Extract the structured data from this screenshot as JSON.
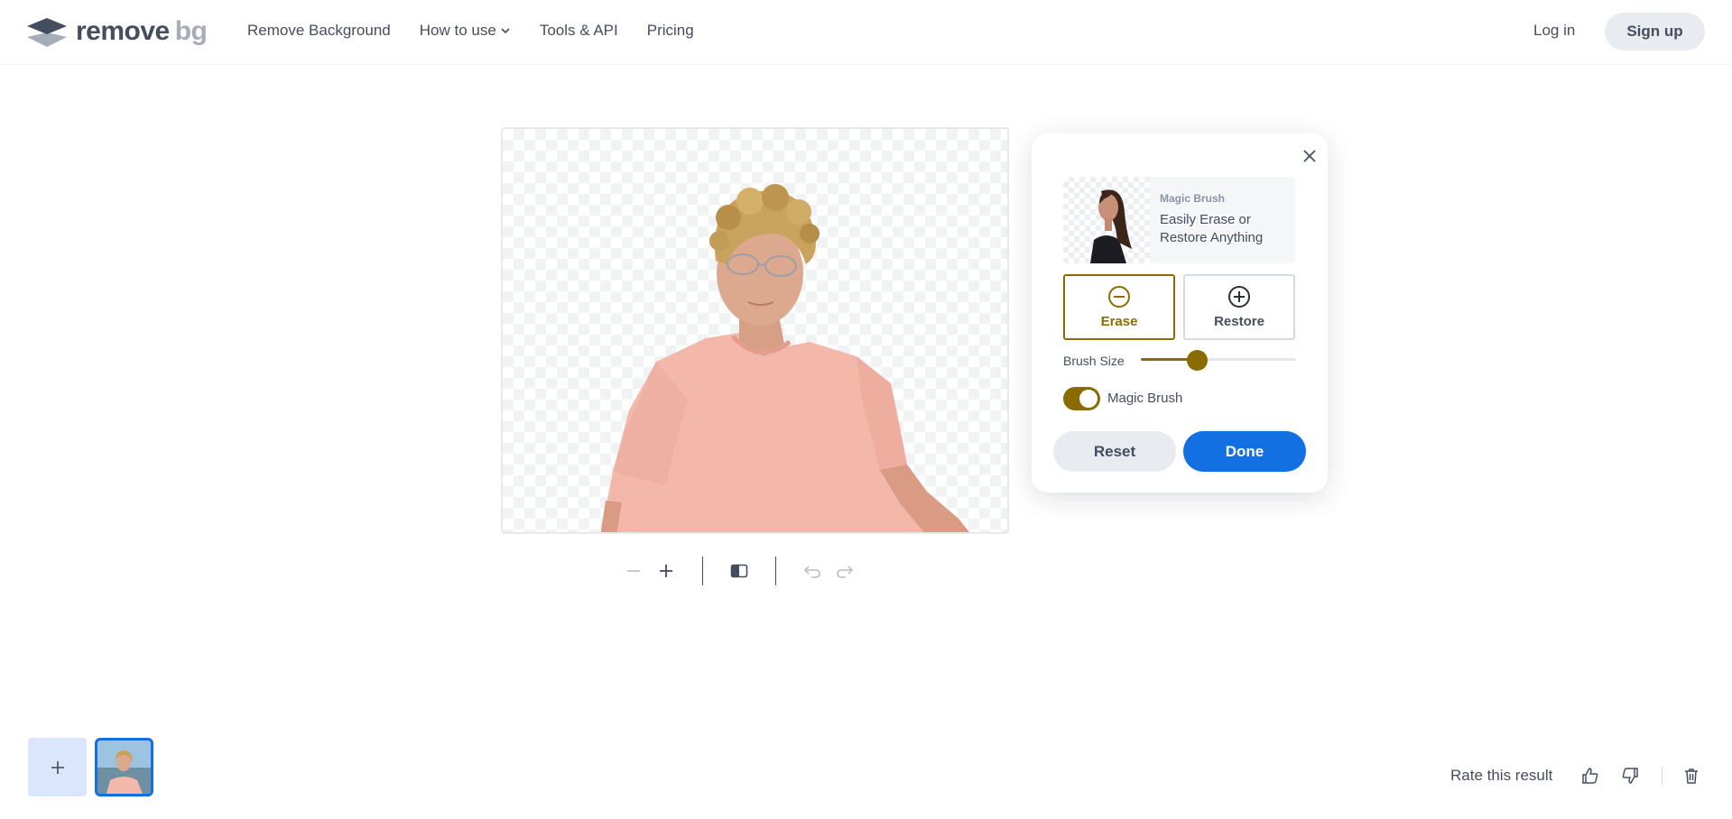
{
  "header": {
    "logo_word": "remove",
    "logo_suffix": "bg",
    "nav": [
      {
        "label": "Remove Background"
      },
      {
        "label": "How to use",
        "has_dropdown": true
      },
      {
        "label": "Tools & API"
      },
      {
        "label": "Pricing"
      }
    ],
    "login_label": "Log in",
    "signup_label": "Sign up"
  },
  "toolbar": {
    "zoom_out_icon": "minus-icon",
    "zoom_in_icon": "plus-icon",
    "compare_icon": "compare-icon",
    "undo_icon": "undo-icon",
    "redo_icon": "redo-icon"
  },
  "panel": {
    "promo_tag": "Magic Brush",
    "promo_text": "Easily Erase or Restore Anything",
    "erase_label": "Erase",
    "restore_label": "Restore",
    "selected_mode": "erase",
    "brush_size_label": "Brush Size",
    "brush_size_fraction": 0.36,
    "magic_brush_label": "Magic Brush",
    "magic_brush_on": true,
    "reset_label": "Reset",
    "done_label": "Done"
  },
  "bottom": {
    "rate_label": "Rate this result"
  },
  "colors": {
    "accent": "#8a6b00",
    "primary": "#1270e3",
    "text": "#454e5e",
    "muted_button": "#e8ebef"
  }
}
